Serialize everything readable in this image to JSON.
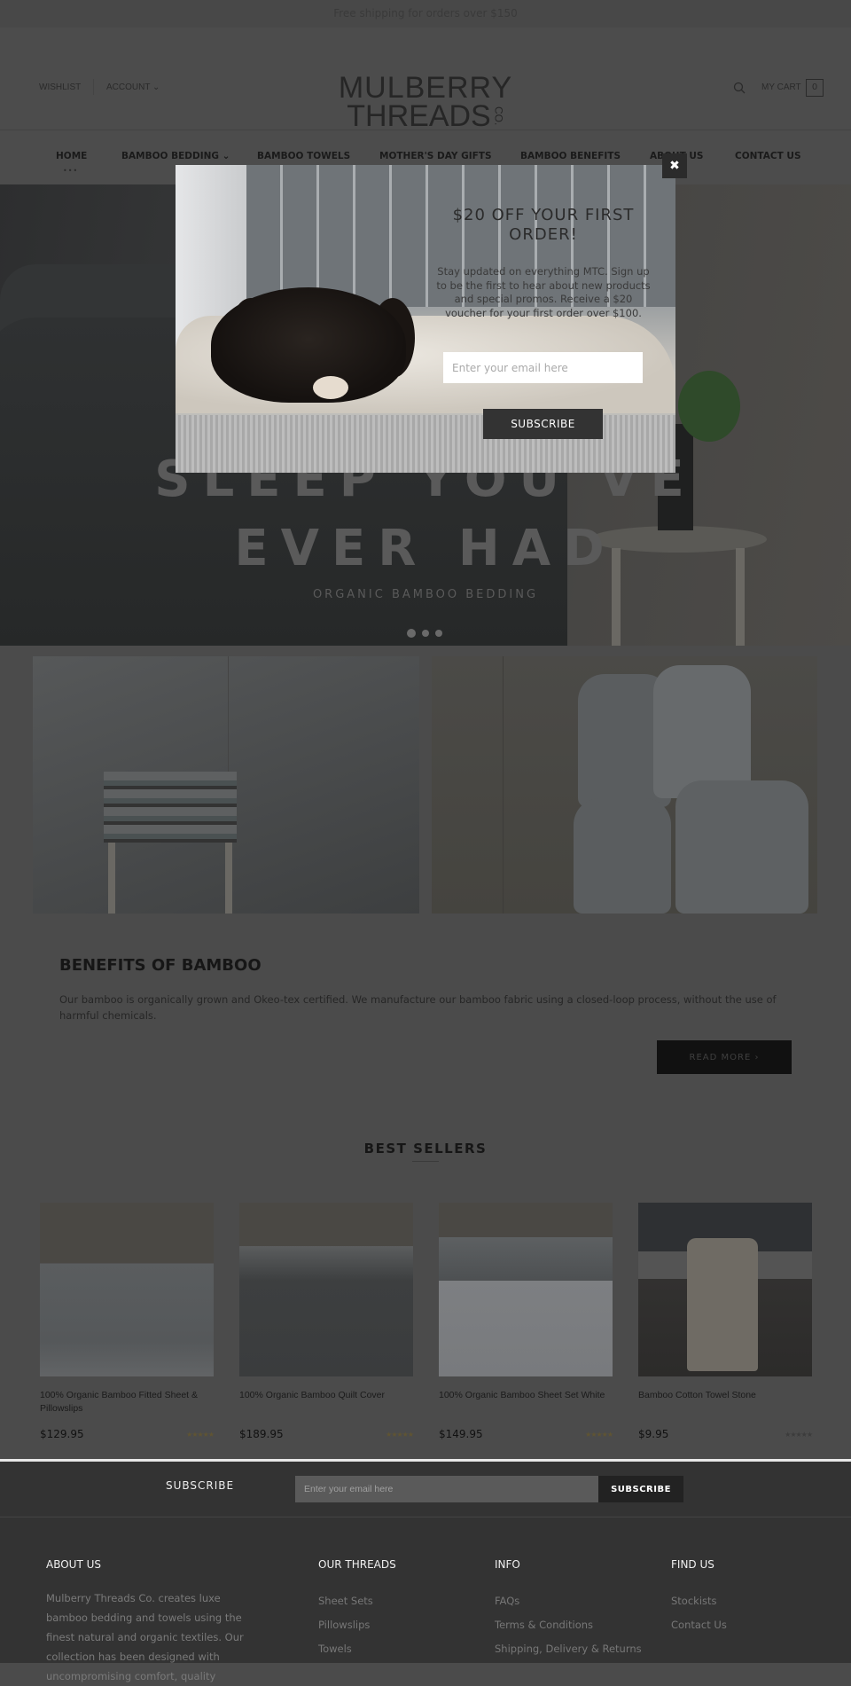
{
  "topbar": {
    "message": "Free shipping for orders over $150"
  },
  "header": {
    "wishlist": "WISHLIST",
    "account": "ACCOUNT",
    "account_chevron": "⌄",
    "logo": {
      "line1": "MULBERRY",
      "line2": "THREADS",
      "suffix": "CO."
    },
    "cart_label": "MY CART",
    "cart_count": "0"
  },
  "nav": {
    "items": [
      {
        "label": "HOME",
        "active": true
      },
      {
        "label": "BAMBOO BEDDING ⌄"
      },
      {
        "label": "BAMBOO TOWELS"
      },
      {
        "label": "MOTHER'S DAY GIFTS"
      },
      {
        "label": "BAMBOO BENEFITS"
      },
      {
        "label": "ABOUT US"
      },
      {
        "label": "CONTACT US"
      }
    ]
  },
  "hero": {
    "line2": "SLEEP YOU'VE",
    "line3": "EVER HAD",
    "subtitle": "ORGANIC BAMBOO BEDDING",
    "slides": 3,
    "active_slide": 1
  },
  "popup": {
    "title": "$20 OFF YOUR FIRST ORDER!",
    "text": "Stay updated on everything MTC. Sign up to be the first to hear about new products and special promos. Receive a $20 voucher for your first order over $100.",
    "email_placeholder": "Enter your email here",
    "subscribe": "SUBSCRIBE",
    "close": "✖"
  },
  "benefits": {
    "title": "BENEFITS OF BAMBOO",
    "text": "Our bamboo is organically grown and Okeo-tex certified. We manufacture our bamboo fabric using a closed-loop process, without the use of harmful chemicals.",
    "button": "READ MORE  ›"
  },
  "best_sellers": {
    "title": "BEST SELLERS",
    "products": [
      {
        "title": "100% Organic Bamboo Fitted Sheet & Pillowslips",
        "price": "$129.95",
        "rating": 5,
        "stars": "★★★★★"
      },
      {
        "title": "100% Organic Bamboo Quilt Cover",
        "price": "$189.95",
        "rating": 5,
        "stars": "★★★★★"
      },
      {
        "title": "100% Organic Bamboo Sheet Set White",
        "price": "$149.95",
        "rating": 5,
        "stars": "★★★★★"
      },
      {
        "title": "Bamboo Cotton Towel Stone",
        "price": "$9.95",
        "rating": 0,
        "stars": "★★★★★"
      }
    ]
  },
  "footer_subscribe": {
    "label": "SUBSCRIBE",
    "placeholder": "Enter your email here",
    "button": "SUBSCRIBE"
  },
  "footer": {
    "about": {
      "title": "ABOUT US",
      "text": "Mulberry Threads Co. creates luxe bamboo bedding and towels using the finest natural and organic textiles. Our collection has been designed with uncompromising comfort, quality"
    },
    "threads": {
      "title": "OUR THREADS",
      "links": [
        "Sheet Sets",
        "Pillowslips",
        "Towels"
      ]
    },
    "info": {
      "title": "INFO",
      "links": [
        "FAQs",
        "Terms & Conditions",
        "Shipping, Delivery & Returns"
      ]
    },
    "find": {
      "title": "FIND US",
      "links": [
        "Stockists",
        "Contact Us"
      ]
    }
  }
}
